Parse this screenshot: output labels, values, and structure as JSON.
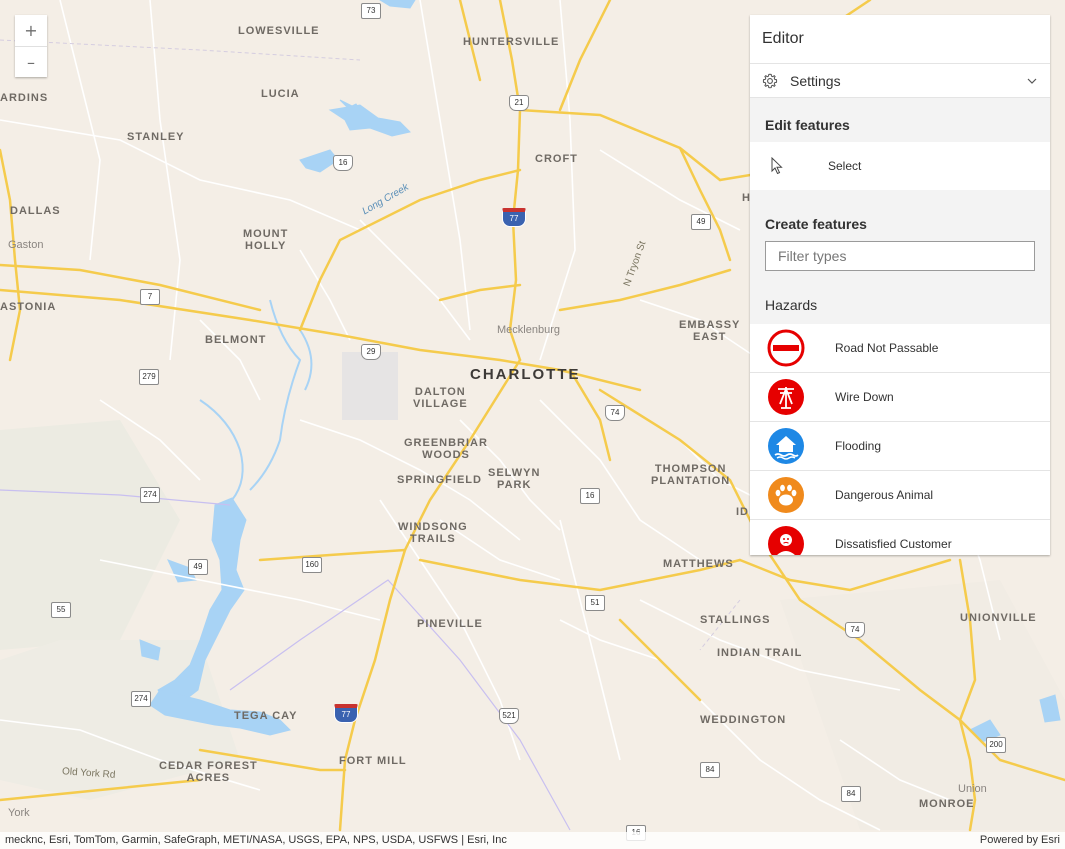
{
  "map": {
    "labels": {
      "charlotte": "CHARLOTTE",
      "huntersville": "HUNTERSVILLE",
      "lowesville": "LOWESVILLE",
      "lucia": "LUCIA",
      "stanley": "STANLEY",
      "dallas": "DALLAS",
      "gaston": "Gaston",
      "mount_holly": "MOUNT\nHOLLY",
      "gastonia": "ASTONIA",
      "ardins": "ARDINS",
      "belmont": "BELMONT",
      "croft": "CROFT",
      "mecklenburg": "Mecklenburg",
      "dalton_village": "DALTON\nVILLAGE",
      "greenbriar_woods": "GREENBRIAR\nWOODS",
      "springfield": "SPRINGFIELD",
      "selwyn_park": "SELWYN\nPARK",
      "windsong_trails": "WINDSONG\nTRAILS",
      "embassy_east": "EMBASSY\nEAST",
      "thompson_plantation": "THOMPSON\nPLANTATION",
      "matthews": "MATTHEWS",
      "stallings": "STALLINGS",
      "indian_trail": "INDIAN TRAIL",
      "pineville": "PINEVILLE",
      "unionville": "UNIONVILLE",
      "weddington": "WEDDINGTON",
      "tega_cay": "TEGA CAY",
      "cedar_forest_acres": "CEDAR FOREST\nACRES",
      "fort_mill": "FORT MILL",
      "monroe": "MONROE",
      "union": "Union",
      "york": "York",
      "old_york_rd": "Old York Rd",
      "long_creek": "Long Creek",
      "n_tryon_st": "N Tryon St",
      "id": "ID",
      "h": "H"
    },
    "shields": {
      "s73": "73",
      "s21": "21",
      "s16a": "16",
      "s77a": "77",
      "s49a": "49",
      "s7": "7",
      "s29": "29",
      "s279": "279",
      "s74a": "74",
      "s274a": "274",
      "s16b": "16",
      "s49b": "49",
      "s160": "160",
      "s55": "55",
      "s51": "51",
      "s74b": "74",
      "s274b": "274",
      "s77b": "77",
      "s521": "521",
      "s84a": "84",
      "s84b": "84",
      "s200": "200",
      "s16c": "16"
    }
  },
  "zoom": {
    "in_label": "+",
    "out_label": "–"
  },
  "editor": {
    "title": "Editor",
    "settings_label": "Settings",
    "edit_heading": "Edit features",
    "select_label": "Select",
    "create_heading": "Create features",
    "filter_placeholder": "Filter types",
    "group_label": "Hazards",
    "items": [
      {
        "label": "Road Not Passable",
        "icon": "no-entry-icon",
        "color": "#e60000"
      },
      {
        "label": "Wire Down",
        "icon": "power-pole-icon",
        "color": "#e60000"
      },
      {
        "label": "Flooding",
        "icon": "flooded-house-icon",
        "color": "#1e88e5"
      },
      {
        "label": "Dangerous Animal",
        "icon": "paw-print-icon",
        "color": "#f08a1c"
      },
      {
        "label": "Dissatisfied Customer",
        "icon": "upset-person-icon",
        "color": "#e60000"
      }
    ]
  },
  "attribution": {
    "sources": "mecknc, Esri, TomTom, Garmin, SafeGraph, METI/NASA, USGS, EPA, NPS, USDA, USFWS | Esri, Inc",
    "powered_by": "Powered by Esri"
  }
}
